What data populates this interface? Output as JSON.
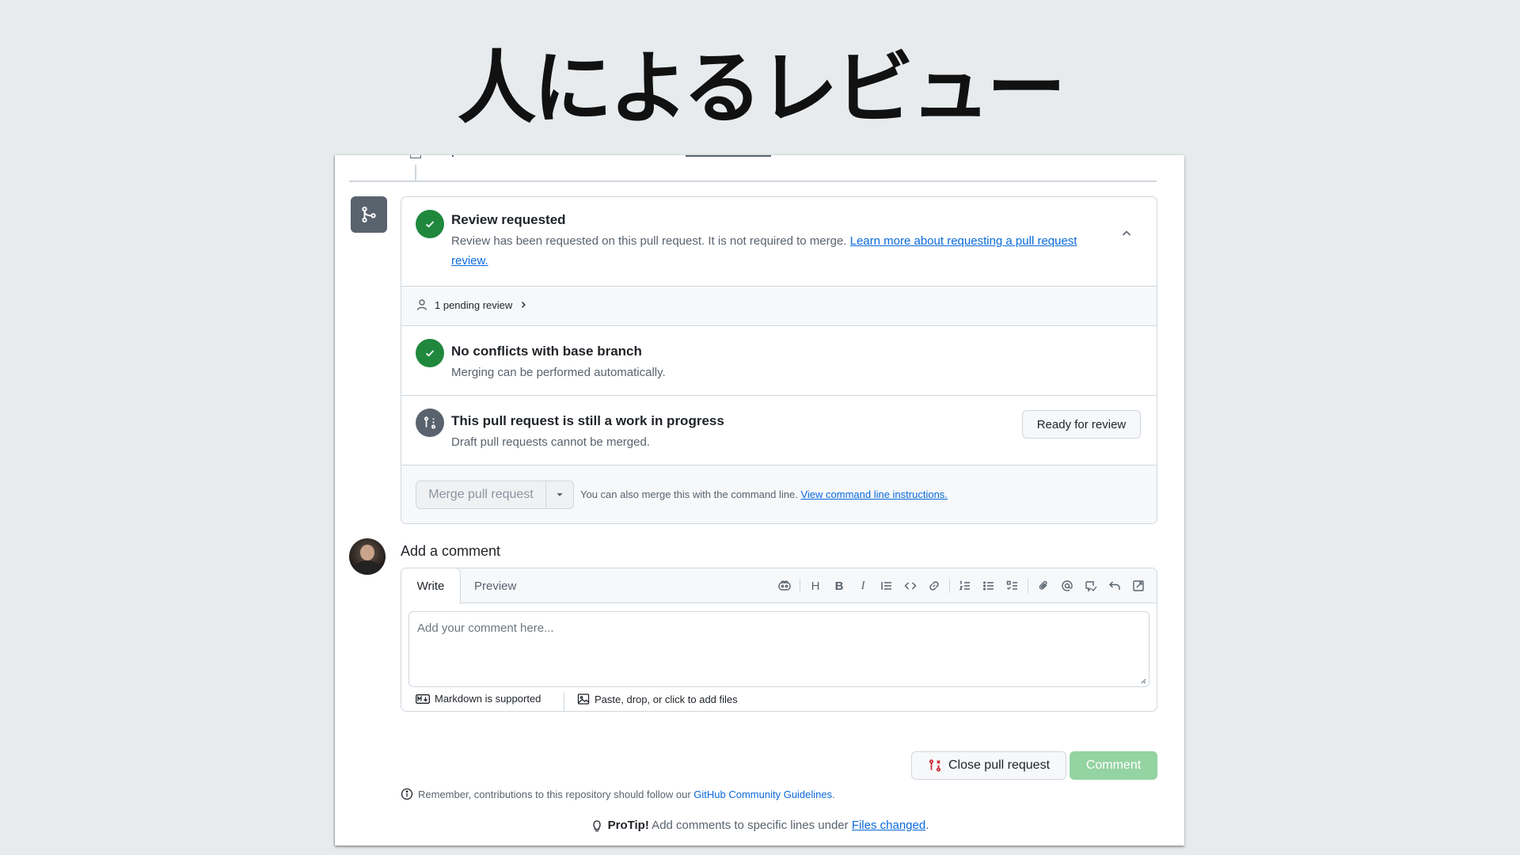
{
  "slide": {
    "title": "人によるレビュー"
  },
  "merge_box": {
    "review": {
      "title": "Review requested",
      "desc": "Review has been requested on this pull request. It is not required to merge. ",
      "link": "Learn more about requesting a pull request review."
    },
    "pending": {
      "label": "1 pending review"
    },
    "no_conflicts": {
      "title": "No conflicts with base branch",
      "desc": "Merging can be performed automatically."
    },
    "wip": {
      "title": "This pull request is still a work in progress",
      "desc": "Draft pull requests cannot be merged.",
      "ready_button": "Ready for review"
    },
    "merge": {
      "button": "Merge pull request",
      "note": "You can also merge this with the command line. ",
      "link": "View command line instructions."
    }
  },
  "comment": {
    "title": "Add a comment",
    "tabs": {
      "write": "Write",
      "preview": "Preview"
    },
    "toolbar": {
      "heading": "H",
      "bold": "B",
      "italic": "I"
    },
    "placeholder": "Add your comment here...",
    "markdown_note": "Markdown is supported",
    "files_note": "Paste, drop, or click to add files",
    "close_button": "Close pull request",
    "comment_button": "Comment"
  },
  "footer": {
    "remember_text": "Remember, contributions to this repository should follow our ",
    "remember_link": "GitHub Community Guidelines",
    "remember_end": ".",
    "protip_label": "ProTip!",
    "protip_text": " Add comments to specific lines under ",
    "protip_link": "Files changed",
    "protip_end": "."
  },
  "colors": {
    "success": "#1f883d",
    "neutral": "#59636e",
    "link": "#0969da",
    "comment_disabled": "#94d3a2",
    "danger": "#cf222e"
  }
}
